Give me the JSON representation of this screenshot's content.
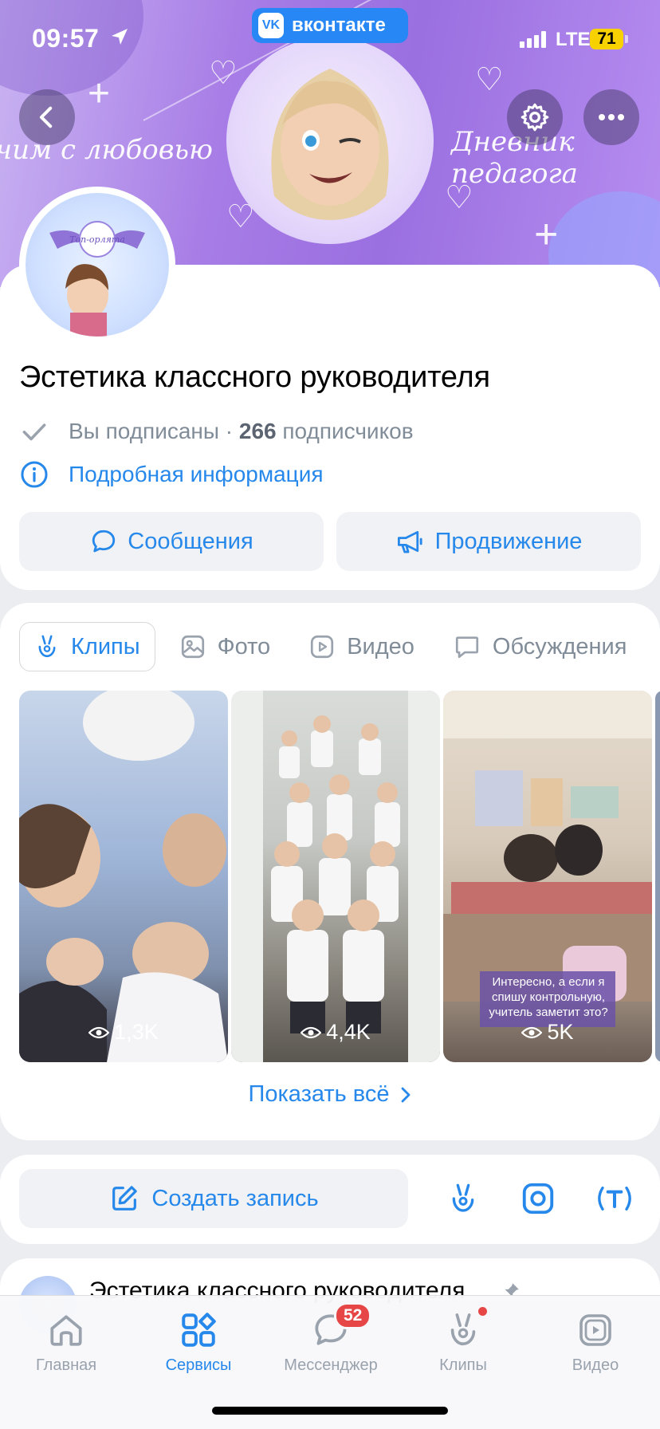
{
  "status_bar": {
    "time": "09:57",
    "carrier_badge": "вконтакте",
    "network": "LTE",
    "battery": "71"
  },
  "cover": {
    "left_script": "чим с любовью",
    "right_script": "Дневник педагога",
    "logo_text": "Топ-орлята"
  },
  "group": {
    "title": "Эстетика классного руководителя",
    "subscribed_label": "Вы подписаны",
    "separator": " · ",
    "subscribers_count": "266",
    "subscribers_label": " подписчиков",
    "info_link": "Подробная информация"
  },
  "actions": {
    "messages": "Сообщения",
    "promotion": "Продвижение"
  },
  "tabs": [
    {
      "label": "Клипы",
      "icon": "clips-icon",
      "active": true
    },
    {
      "label": "Фото",
      "icon": "photo-icon",
      "active": false
    },
    {
      "label": "Видео",
      "icon": "video-icon",
      "active": false
    },
    {
      "label": "Обсуждения",
      "icon": "discussion-icon",
      "active": false
    }
  ],
  "clips": [
    {
      "views": "1,3K"
    },
    {
      "views": "4,4K"
    },
    {
      "views": "5K",
      "caption": "Интересно, а если я спишу контрольную, учитель заметит это?"
    }
  ],
  "show_all": "Показать всё",
  "create_post": "Создать запись",
  "post": {
    "author": "Эстетика классного руководителя"
  },
  "tabbar": [
    {
      "label": "Главная",
      "icon": "home-icon"
    },
    {
      "label": "Сервисы",
      "icon": "services-icon",
      "active": true
    },
    {
      "label": "Мессенджер",
      "icon": "messenger-icon",
      "badge": "52"
    },
    {
      "label": "Клипы",
      "icon": "clips-icon"
    },
    {
      "label": "Видео",
      "icon": "video-icon"
    }
  ],
  "colors": {
    "accent": "#2688eb",
    "secondary_text": "#818c99",
    "badge": "#e64646",
    "cover": "#a77ce6"
  }
}
